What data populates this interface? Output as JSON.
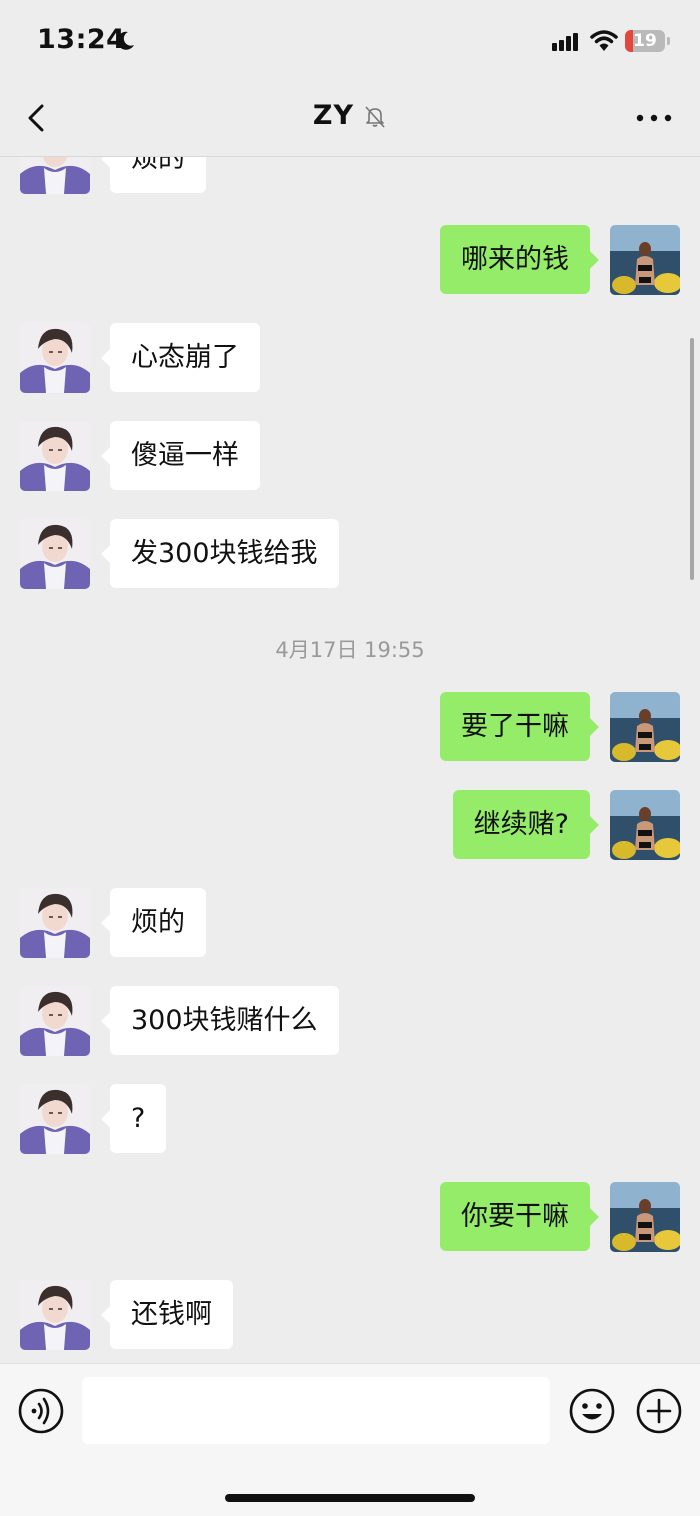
{
  "status_bar": {
    "time": "13:24",
    "battery_level": "19",
    "battery_fraction": 0.19,
    "icons": [
      "moon-icon",
      "cellular-signal-icon",
      "wifi-icon",
      "battery-icon"
    ]
  },
  "nav": {
    "title": "ZY",
    "icons": [
      "back-chevron-icon",
      "mute-bell-icon",
      "more-dots-icon"
    ]
  },
  "messages": [
    {
      "side": "in",
      "text": "烦的"
    },
    {
      "side": "out",
      "text": "哪来的钱"
    },
    {
      "side": "in",
      "text": "心态崩了"
    },
    {
      "side": "in",
      "text": "傻逼一样"
    },
    {
      "side": "in",
      "text": "发300块钱给我"
    },
    {
      "side": "time",
      "text": "4月17日 19:55"
    },
    {
      "side": "out",
      "text": "要了干嘛"
    },
    {
      "side": "out",
      "text": "继续赌?"
    },
    {
      "side": "in",
      "text": "烦的"
    },
    {
      "side": "in",
      "text": "300块钱赌什么"
    },
    {
      "side": "in",
      "text": "?"
    },
    {
      "side": "out",
      "text": "你要干嘛"
    },
    {
      "side": "in",
      "text": "还钱啊"
    }
  ],
  "input_bar": {
    "text_value": "",
    "icons": [
      "voice-icon",
      "emoji-icon",
      "plus-icon"
    ]
  },
  "colors": {
    "background": "#ededed",
    "outgoing_bubble": "#95ec69",
    "incoming_bubble": "#ffffff",
    "battery_low": "#e5463c"
  }
}
